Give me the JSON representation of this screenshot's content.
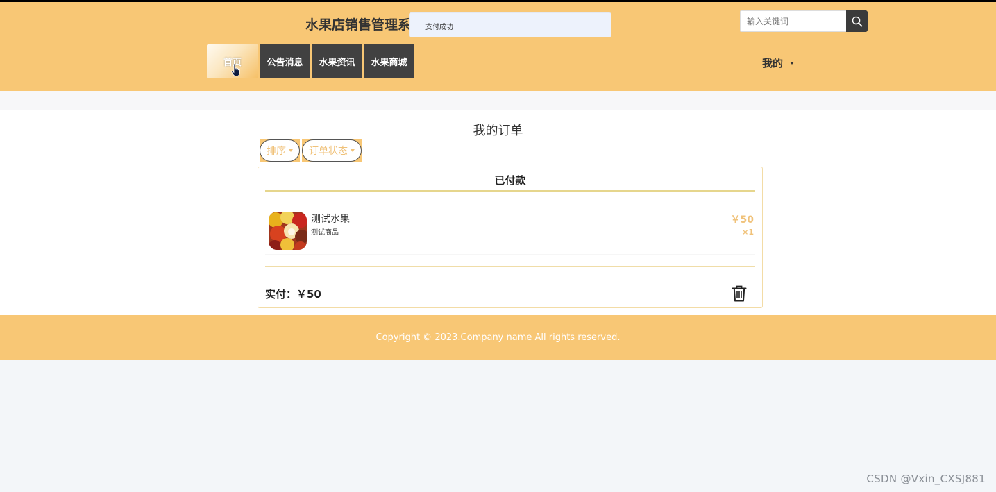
{
  "header": {
    "site_title": "水果店销售管理系",
    "toast": "支付成功",
    "search_placeholder": "输入关键词",
    "mine_label": "我的"
  },
  "nav": {
    "items": [
      {
        "label": "首页"
      },
      {
        "label": "公告消息"
      },
      {
        "label": "水果资讯"
      },
      {
        "label": "水果商城"
      }
    ]
  },
  "main": {
    "page_title": "我的订单",
    "filters": {
      "sort_label": "排序",
      "status_label": "订单状态"
    },
    "order": {
      "status": "已付款",
      "item": {
        "name": "测试水果",
        "desc": "测试商品",
        "price": "￥50",
        "qty": "×1"
      },
      "paid_label": "实付：￥50"
    }
  },
  "footer": {
    "copyright": "Copyright © 2023.Company name All rights reserved."
  },
  "watermark": "CSDN @Vxin_CXSJ881",
  "colors": {
    "brand": "#f8c775",
    "nav_dark": "#414141",
    "price": "#f0c27a"
  }
}
